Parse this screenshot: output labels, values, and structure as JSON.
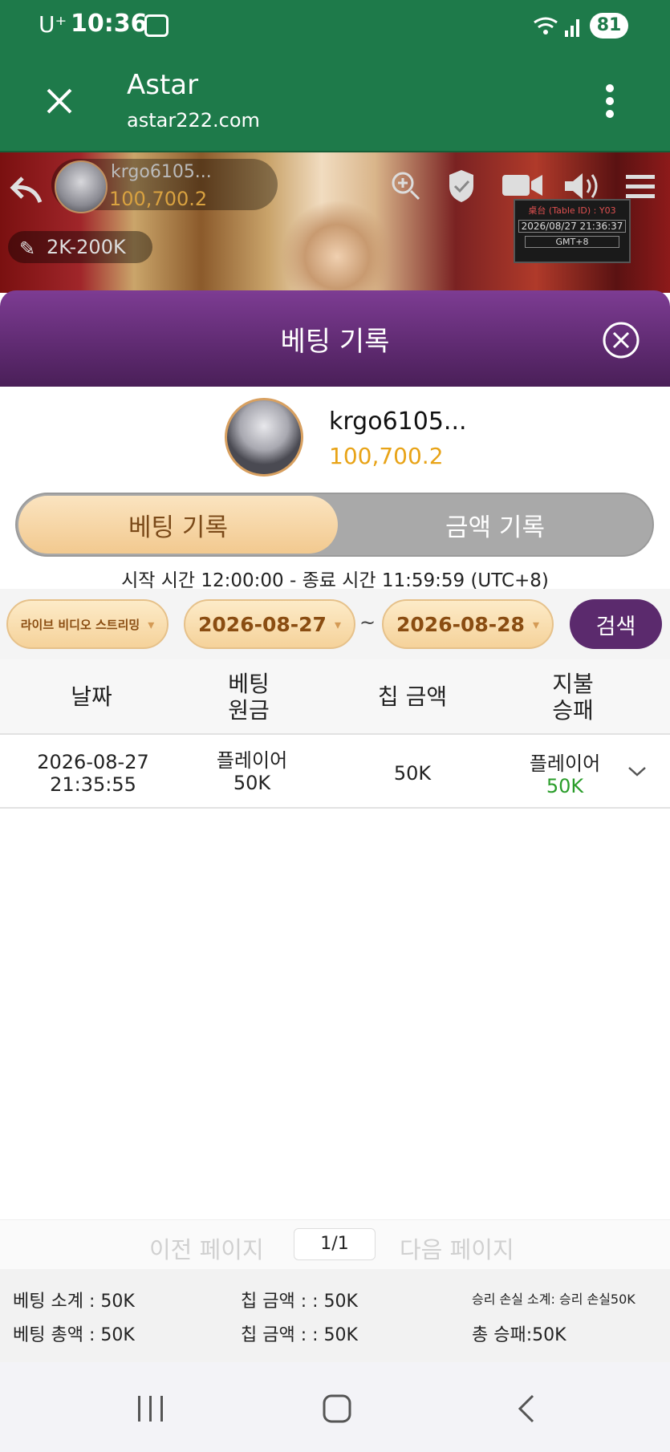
{
  "status_bar": {
    "carrier": "U⁺",
    "time": "10:36",
    "battery": "81"
  },
  "toolbar": {
    "title": "Astar",
    "url": "astar222.com"
  },
  "game": {
    "username": "krgo6105...",
    "balance": "100,700.2",
    "bet_range": "2K-200K",
    "table_id": "桌台 (Table ID) : Y03",
    "datetime": "2026/08/27 21:36:37",
    "timezone": "GMT+8"
  },
  "panel": {
    "title": "베팅 기록"
  },
  "user": {
    "name": "krgo6105...",
    "balance": "100,700.2"
  },
  "tabs": [
    {
      "label": "베팅 기록"
    },
    {
      "label": "금액 기록"
    }
  ],
  "time_range": "시작 시간 12:00:00 - 종료 시간 11:59:59 (UTC+8)",
  "filters": {
    "game_type": "라이브 비디오 스트리밍",
    "date_from": "2026-08-27",
    "separator": "~",
    "date_to": "2026-08-28",
    "search_label": "검색"
  },
  "table": {
    "headers": [
      "날짜",
      "베팅\n원금",
      "칩 금액",
      "지불\n승패"
    ],
    "rows": [
      {
        "date": "2026-08-27",
        "time": "21:35:55",
        "bet_side": "플레이어",
        "bet_amount": "50K",
        "chip_amount": "50K",
        "result_side": "플레이어",
        "result_amount": "50K"
      }
    ]
  },
  "pagination": {
    "prev": "이전 페이지",
    "page": "1/1",
    "next": "다음 페이지"
  },
  "summary": {
    "bet_subtotal": "베팅 소계 : 50K",
    "chip_1": "칩 금액 : : 50K",
    "winloss_subtotal": "승리 손실 소계: 승리 손실50K",
    "bet_total": "베팅 총액 : 50K",
    "chip_2": "칩 금액 : : 50K",
    "total_winloss": "총 승패:50K"
  },
  "colors": {
    "toolbar": "#1e7a4a",
    "panel": "#6a2f7e",
    "gold": "#e8a317",
    "win_green": "#2a9d2a"
  }
}
